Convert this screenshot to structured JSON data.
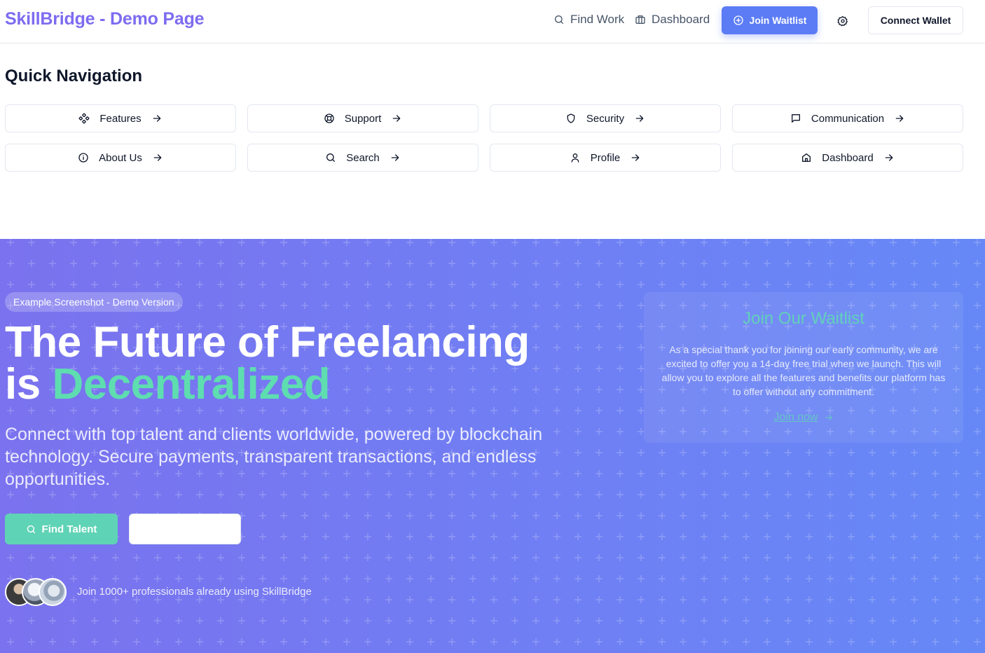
{
  "header": {
    "brand": "SkillBridge - Demo Page",
    "nav": [
      {
        "label": "Find Work",
        "icon": "search-icon"
      },
      {
        "label": "Dashboard",
        "icon": "briefcase-icon"
      }
    ],
    "waitlist_button": "Join Waitlist",
    "wallet_button": "Connect Wallet"
  },
  "quick_nav": {
    "title": "Quick Navigation",
    "items": [
      {
        "label": "Features",
        "icon": "features-icon"
      },
      {
        "label": "Support",
        "icon": "lifebuoy-icon"
      },
      {
        "label": "Security",
        "icon": "shield-icon"
      },
      {
        "label": "Communication",
        "icon": "message-icon"
      },
      {
        "label": "About Us",
        "icon": "info-icon"
      },
      {
        "label": "Search",
        "icon": "search-icon"
      },
      {
        "label": "Profile",
        "icon": "user-icon"
      },
      {
        "label": "Dashboard",
        "icon": "home-icon"
      }
    ]
  },
  "hero": {
    "badge": "Example Screenshot - Demo Version",
    "headline_line1": "The Future of Freelancing",
    "headline_is": "is ",
    "headline_accent": "Decentralized",
    "subtext": "Connect with top talent and clients worldwide, powered by blockchain technology. Secure payments, transparent transactions, and endless opportunities.",
    "primary_button": "Find Talent",
    "social_proof": "Join 1000+ professionals already using SkillBridge"
  },
  "waitlist_card": {
    "title": "Join Our Waitlist",
    "body": "As a special thank you for joining our early community, we are excited to offer you a 14-day free trial when we launch. This will allow you to explore all the features and benefits our platform has to offer without any commitment.",
    "link": "Join now"
  },
  "colors": {
    "brand": "#7c6cf0",
    "accent_green": "#5eddb0",
    "primary_blue": "#5b7cf5",
    "hero_bg": "#7576ee"
  }
}
